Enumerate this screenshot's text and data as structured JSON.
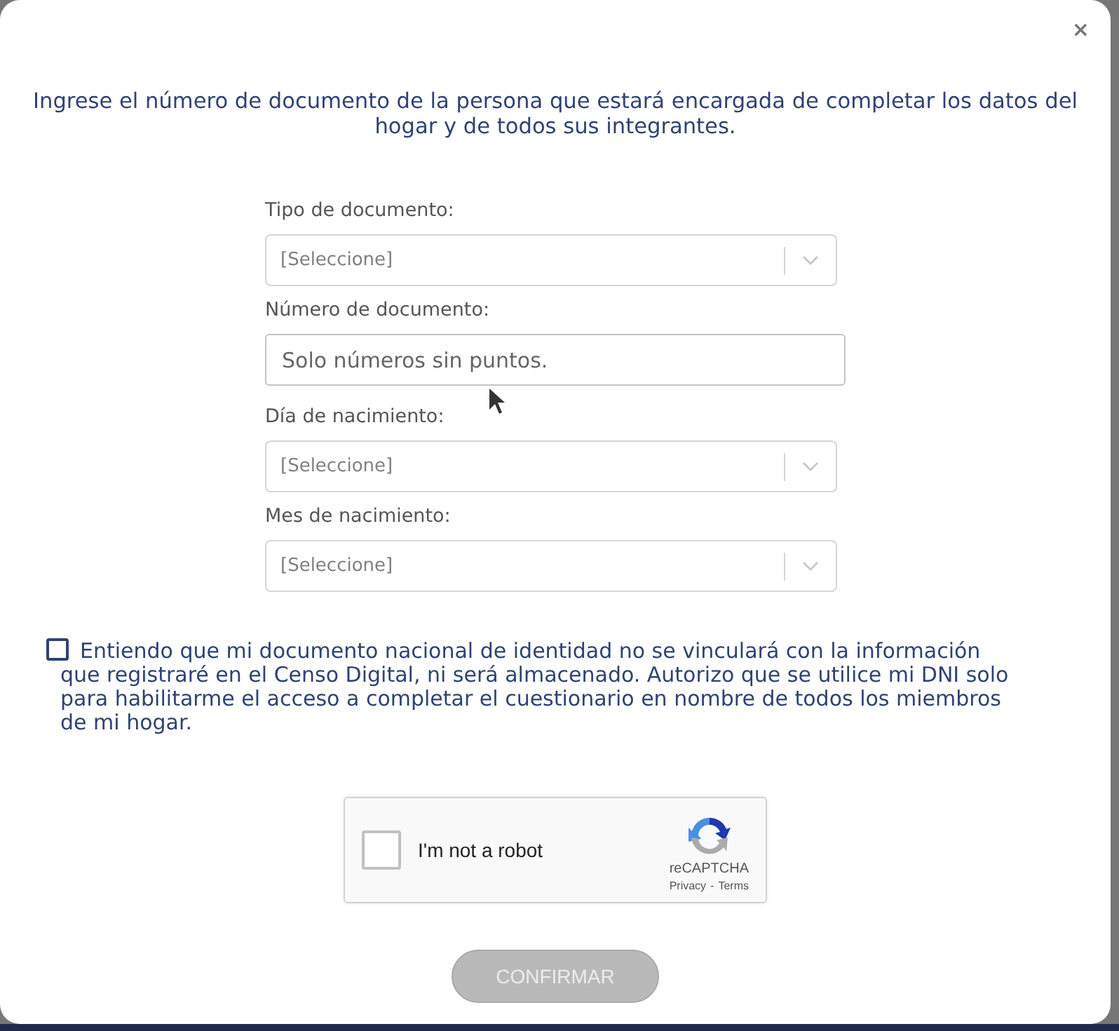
{
  "dialog": {
    "close": "×",
    "intro": "Ingrese el número de documento de la persona que estará encargada de completar los datos del hogar y de todos sus integrantes.",
    "fields": [
      {
        "kind": "select",
        "label": "Tipo de documento:",
        "placeholder": "[Seleccione]"
      },
      {
        "kind": "input",
        "label": "Número de documento:",
        "placeholder": "Solo números sin puntos."
      },
      {
        "kind": "select",
        "label": "Día de nacimiento:",
        "placeholder": "[Seleccione]"
      },
      {
        "kind": "select",
        "label": "Mes de nacimiento:",
        "placeholder": "[Seleccione]"
      }
    ],
    "consent": {
      "checked": false,
      "text": "Entiendo que mi documento nacional de identidad no se vinculará con la información que registraré en el Censo Digital, ni será almacenado. Autorizo que se utilice mi DNI solo para habilitarme el acceso a completar el cuestionario en nombre de todos los miembros de mi hogar."
    },
    "captcha": {
      "checked": false,
      "label": "I'm not a robot",
      "brand": "reCAPTCHA",
      "privacy": "Privacy",
      "separator": "-",
      "terms": "Terms"
    },
    "confirm": {
      "label": "CONFIRMAR",
      "disabled": true
    }
  }
}
